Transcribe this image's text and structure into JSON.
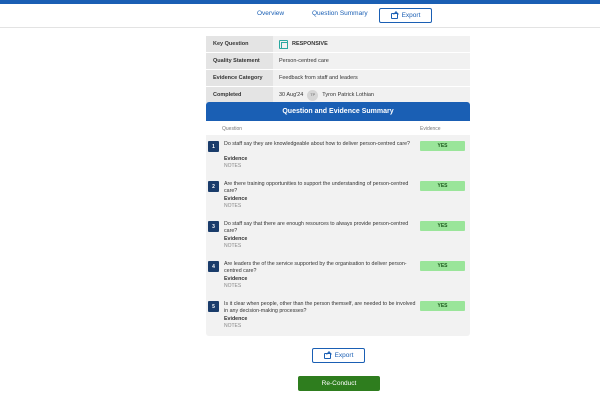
{
  "nav": {
    "tabs": [
      "Overview",
      "Question Summary"
    ],
    "export_label": "Export"
  },
  "info": {
    "rows": [
      {
        "key": "Key Question",
        "value": "RESPONSIVE"
      },
      {
        "key": "Quality Statement",
        "value": "Person-centred care"
      },
      {
        "key": "Evidence Category",
        "value": "Feedback from staff and leaders"
      },
      {
        "key": "Completed",
        "value": "30 Aug'24",
        "avatar": "TP",
        "person": "Tyron Patrick Lothian"
      }
    ]
  },
  "summary": {
    "title": "Question and Evidence Summary",
    "col_question": "Question",
    "col_evidence": "Evidence",
    "questions": [
      {
        "num": "1",
        "text": "Do staff say they are knowledgeable about how to deliver person-centred care?",
        "evidence_label": "Evidence",
        "notes": "NOTES",
        "result": "YES"
      },
      {
        "num": "2",
        "text": "Are there training opportunities to support the understanding of person-centred care?",
        "evidence_label": "Evidence",
        "notes": "NOTES",
        "result": "YES"
      },
      {
        "num": "3",
        "text": "Do staff say that there are enough resources to always provide person-centred care?",
        "evidence_label": "Evidence",
        "notes": "NOTES",
        "result": "YES"
      },
      {
        "num": "4",
        "text": "Are leaders the of the service supported by the organisation to deliver person-centred care?",
        "evidence_label": "Evidence",
        "notes": "NOTES",
        "result": "YES"
      },
      {
        "num": "5",
        "text": "Is it clear when people, other than the person themself, are needed to be involved in any decision-making processes?",
        "evidence_label": "Evidence",
        "notes": "NOTES",
        "result": "YES"
      }
    ]
  },
  "actions": {
    "export_label": "Export",
    "reconduct_label": "Re-Conduct"
  },
  "colors": {
    "brand_blue": "#1a5fb4",
    "yes_green": "#9ae59a",
    "action_green": "#2e7d1e"
  }
}
